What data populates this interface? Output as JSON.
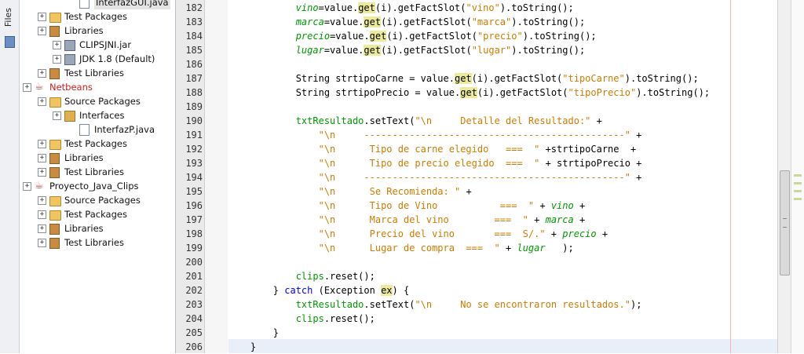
{
  "sidebar": {
    "files_tab_label": "Files"
  },
  "tree": [
    {
      "label": "InterfazGUI.java",
      "depth": 4,
      "icon": "java-file-icon",
      "selected": true
    },
    {
      "label": "Test Packages",
      "depth": 2,
      "icon": "folder-icon"
    },
    {
      "label": "Libraries",
      "depth": 2,
      "icon": "library-icon"
    },
    {
      "label": "CLIPSJNI.jar",
      "depth": 3,
      "icon": "jar-icon"
    },
    {
      "label": "JDK 1.8 (Default)",
      "depth": 3,
      "icon": "jar-icon"
    },
    {
      "label": "Test Libraries",
      "depth": 2,
      "icon": "library-icon"
    },
    {
      "label": "Netbeans",
      "depth": 1,
      "icon": "project-icon",
      "error": true
    },
    {
      "label": "Source Packages",
      "depth": 2,
      "icon": "folder-icon"
    },
    {
      "label": "Interfaces",
      "depth": 3,
      "icon": "package-icon"
    },
    {
      "label": "InterfazP.java",
      "depth": 4,
      "icon": "java-file-icon"
    },
    {
      "label": "Test Packages",
      "depth": 2,
      "icon": "folder-icon"
    },
    {
      "label": "Libraries",
      "depth": 2,
      "icon": "library-icon"
    },
    {
      "label": "Test Libraries",
      "depth": 2,
      "icon": "library-icon"
    },
    {
      "label": "Proyecto_Java_Clips",
      "depth": 1,
      "icon": "project-icon"
    },
    {
      "label": "Source Packages",
      "depth": 2,
      "icon": "folder-icon"
    },
    {
      "label": "Test Packages",
      "depth": 2,
      "icon": "folder-icon"
    },
    {
      "label": "Libraries",
      "depth": 2,
      "icon": "library-icon"
    },
    {
      "label": "Test Libraries",
      "depth": 2,
      "icon": "library-icon"
    }
  ],
  "editor": {
    "line_numbers": [
      "182",
      "183",
      "184",
      "185",
      "186",
      "187",
      "188",
      "189",
      "190",
      "191",
      "192",
      "193",
      "194",
      "195",
      "196",
      "197",
      "198",
      "199",
      "200",
      "201",
      "202",
      "203",
      "204",
      "205",
      "206"
    ],
    "lines": [
      [
        {
          "t": "            "
        },
        {
          "t": "vino",
          "c": "it"
        },
        {
          "t": "=value."
        },
        {
          "t": "get",
          "c": "hl"
        },
        {
          "t": "(i).getFactSlot("
        },
        {
          "t": "\"vino\"",
          "c": "str"
        },
        {
          "t": ").toString();"
        }
      ],
      [
        {
          "t": "            "
        },
        {
          "t": "marca",
          "c": "it"
        },
        {
          "t": "=value."
        },
        {
          "t": "get",
          "c": "hl"
        },
        {
          "t": "(i).getFactSlot("
        },
        {
          "t": "\"marca\"",
          "c": "str"
        },
        {
          "t": ").toString();"
        }
      ],
      [
        {
          "t": "            "
        },
        {
          "t": "precio",
          "c": "it"
        },
        {
          "t": "=value."
        },
        {
          "t": "get",
          "c": "hl"
        },
        {
          "t": "(i).getFactSlot("
        },
        {
          "t": "\"precio\"",
          "c": "str"
        },
        {
          "t": ").toString();"
        }
      ],
      [
        {
          "t": "            "
        },
        {
          "t": "lugar",
          "c": "it"
        },
        {
          "t": "=value."
        },
        {
          "t": "get",
          "c": "hl"
        },
        {
          "t": "(i).getFactSlot("
        },
        {
          "t": "\"lugar\"",
          "c": "str"
        },
        {
          "t": ").toString();"
        }
      ],
      [
        {
          "t": ""
        }
      ],
      [
        {
          "t": "            String strtipoCarne = value."
        },
        {
          "t": "get",
          "c": "hl"
        },
        {
          "t": "(i).getFactSlot("
        },
        {
          "t": "\"tipoCarne\"",
          "c": "str"
        },
        {
          "t": ").toString();"
        }
      ],
      [
        {
          "t": "            String strtipoPrecio = value."
        },
        {
          "t": "get",
          "c": "hl"
        },
        {
          "t": "(i).getFactSlot("
        },
        {
          "t": "\"tipoPrecio\"",
          "c": "str"
        },
        {
          "t": ").toString();"
        }
      ],
      [
        {
          "t": ""
        }
      ],
      [
        {
          "t": "            "
        },
        {
          "t": "txtResultado",
          "c": "fld"
        },
        {
          "t": ".setText("
        },
        {
          "t": "\"\\n     Detalle del Resultado:\"",
          "c": "str"
        },
        {
          "t": " +"
        }
      ],
      [
        {
          "t": "                "
        },
        {
          "t": "\"\\n     ----------------------------------------------\"",
          "c": "str"
        },
        {
          "t": " +"
        }
      ],
      [
        {
          "t": "                "
        },
        {
          "t": "\"\\n      Tipo de carne elegido   ===  \"",
          "c": "str"
        },
        {
          "t": " +strtipoCarne  +"
        }
      ],
      [
        {
          "t": "                "
        },
        {
          "t": "\"\\n      Tipo de precio elegido  ===  \"",
          "c": "str"
        },
        {
          "t": " + strtipoPrecio +"
        }
      ],
      [
        {
          "t": "                "
        },
        {
          "t": "\"\\n     ----------------------------------------------\"",
          "c": "str"
        },
        {
          "t": " +"
        }
      ],
      [
        {
          "t": "                "
        },
        {
          "t": "\"\\n      Se Recomienda: \"",
          "c": "str"
        },
        {
          "t": " +"
        }
      ],
      [
        {
          "t": "                "
        },
        {
          "t": "\"\\n      Tipo de Vino           ===  \"",
          "c": "str"
        },
        {
          "t": " + "
        },
        {
          "t": "vino",
          "c": "it"
        },
        {
          "t": " +"
        }
      ],
      [
        {
          "t": "                "
        },
        {
          "t": "\"\\n      Marca del vino        ===  \"",
          "c": "str"
        },
        {
          "t": " + "
        },
        {
          "t": "marca",
          "c": "it"
        },
        {
          "t": " +"
        }
      ],
      [
        {
          "t": "                "
        },
        {
          "t": "\"\\n      Precio del vino       ===  S/.\"",
          "c": "str"
        },
        {
          "t": " + "
        },
        {
          "t": "precio",
          "c": "it"
        },
        {
          "t": " +"
        }
      ],
      [
        {
          "t": "                "
        },
        {
          "t": "\"\\n      Lugar de compra  ===  \"",
          "c": "str"
        },
        {
          "t": " + "
        },
        {
          "t": "lugar",
          "c": "it"
        },
        {
          "t": "   );"
        }
      ],
      [
        {
          "t": ""
        }
      ],
      [
        {
          "t": "            "
        },
        {
          "t": "clips",
          "c": "fld"
        },
        {
          "t": ".reset();"
        }
      ],
      [
        {
          "t": "        } "
        },
        {
          "t": "catch",
          "c": "kw"
        },
        {
          "t": " (Exception "
        },
        {
          "t": "ex",
          "c": "hl"
        },
        {
          "t": ") {"
        }
      ],
      [
        {
          "t": "            "
        },
        {
          "t": "txtResultado",
          "c": "fld"
        },
        {
          "t": ".setText("
        },
        {
          "t": "\"\\n     No se encontraron resultados.\"",
          "c": "str"
        },
        {
          "t": ");"
        }
      ],
      [
        {
          "t": "            "
        },
        {
          "t": "clips",
          "c": "fld"
        },
        {
          "t": ".reset();"
        }
      ],
      [
        {
          "t": "        }"
        }
      ],
      [
        {
          "t": "    }"
        }
      ]
    ]
  },
  "colors": {
    "string": "#ce7b00",
    "keyword": "#0000e6",
    "field": "#009900",
    "highlight": "#eceb9a",
    "error_label": "#d21c1c"
  }
}
